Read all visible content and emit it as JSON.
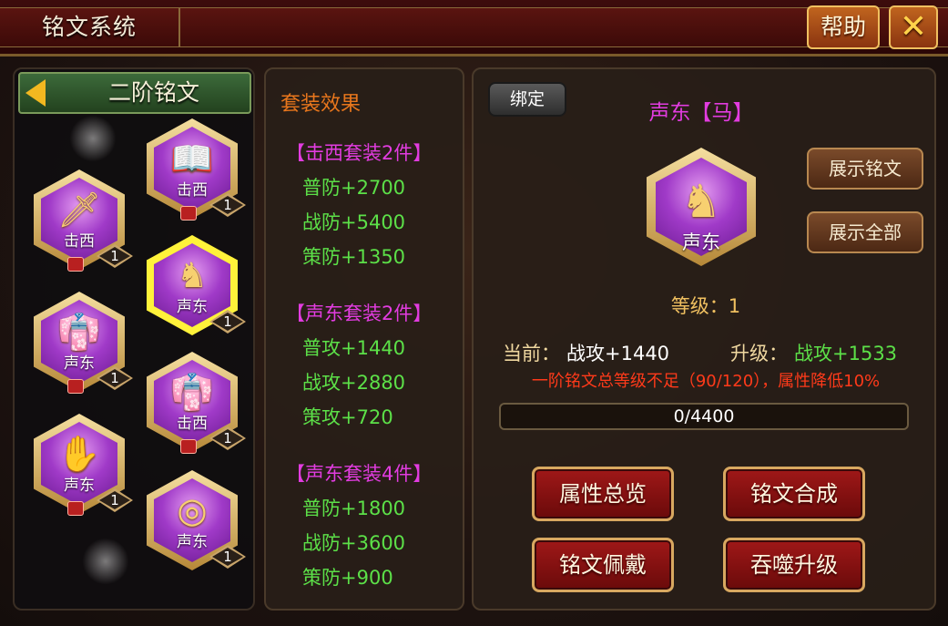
{
  "window": {
    "title": "铭文系统",
    "help_label": "帮助",
    "close_icon": "x-close-icon"
  },
  "left": {
    "header": "二阶铭文",
    "gems": [
      {
        "name": "击西",
        "level": "1",
        "icon": "book-icon",
        "glyph": "📖",
        "locked": true,
        "selected": false
      },
      {
        "name": "击西",
        "level": "1",
        "icon": "sword-icon",
        "glyph": "🗡",
        "locked": true,
        "selected": false
      },
      {
        "name": "声东",
        "level": "1",
        "icon": "horse-icon",
        "glyph": "♞",
        "locked": false,
        "selected": true
      },
      {
        "name": "声东",
        "level": "1",
        "icon": "robe-icon",
        "glyph": "👘",
        "locked": true,
        "selected": false
      },
      {
        "name": "击西",
        "level": "1",
        "icon": "robe-icon",
        "glyph": "👘",
        "locked": true,
        "selected": false
      },
      {
        "name": "声东",
        "level": "1",
        "icon": "glove-icon",
        "glyph": "✋",
        "locked": true,
        "selected": false
      },
      {
        "name": "声东",
        "level": "1",
        "icon": "bracelet-icon",
        "glyph": "◎",
        "locked": false,
        "selected": false
      }
    ]
  },
  "sets": {
    "title": "套装效果",
    "groups": [
      {
        "header": "【击西套装2件】",
        "stats": [
          "普防+2700",
          "战防+5400",
          "策防+1350"
        ]
      },
      {
        "header": "【声东套装2件】",
        "stats": [
          "普攻+1440",
          "战攻+2880",
          "策攻+720"
        ]
      },
      {
        "header": "【声东套装4件】",
        "stats": [
          "普防+1800",
          "战防+3600",
          "策防+900"
        ]
      }
    ]
  },
  "detail": {
    "bind_label": "绑定",
    "name": "声东【马】",
    "gem": {
      "name": "声东",
      "icon": "horse-icon",
      "glyph": "♞"
    },
    "show_inscription": "展示铭文",
    "show_all": "展示全部",
    "level_text": "等级：1",
    "current_label": "当前：",
    "current_value": "战攻+1440",
    "upgrade_label": "升级：",
    "upgrade_value": "战攻+1533",
    "warning": "一阶铭文总等级不足（90/120），属性降低10%",
    "progress": {
      "text": "0/4400",
      "fraction": 0
    },
    "buttons": {
      "overview": "属性总览",
      "compose": "铭文合成",
      "wear": "铭文佩戴",
      "devour": "吞噬升级"
    }
  },
  "colors": {
    "set_title": "#e8761c",
    "set_header": "#e23ce0",
    "stat_green": "#5ce048",
    "warning": "#ff3a1a",
    "level_gold": "#f0c060"
  }
}
